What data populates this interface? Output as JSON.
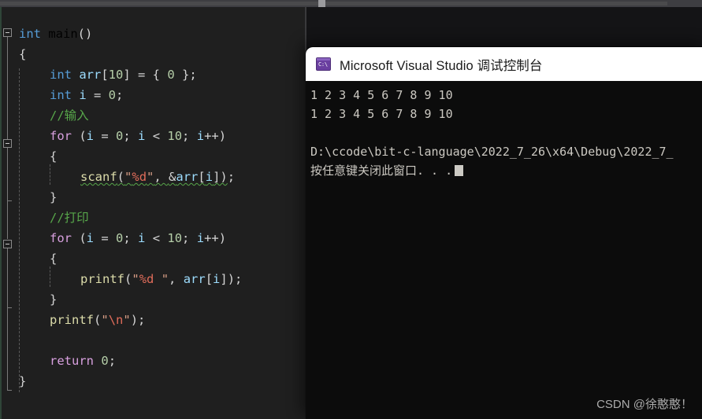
{
  "window": {
    "app": "Visual Studio",
    "theme": "dark"
  },
  "editor": {
    "name": "code-editor",
    "language": "C",
    "code_lines": [
      {
        "indent": 0,
        "tokens": [
          {
            "t": "int ",
            "c": "kw"
          },
          {
            "t": "main",
            "c": "fn-plain"
          },
          {
            "t": "()",
            "c": "punc"
          }
        ]
      },
      {
        "indent": 0,
        "tokens": [
          {
            "t": "{",
            "c": "punc"
          }
        ]
      },
      {
        "indent": 1,
        "tokens": [
          {
            "t": "int ",
            "c": "kw"
          },
          {
            "t": "arr",
            "c": "var"
          },
          {
            "t": "[",
            "c": "punc"
          },
          {
            "t": "10",
            "c": "num"
          },
          {
            "t": "] = { ",
            "c": "punc"
          },
          {
            "t": "0",
            "c": "num"
          },
          {
            "t": " };",
            "c": "punc"
          }
        ]
      },
      {
        "indent": 1,
        "tokens": [
          {
            "t": "int ",
            "c": "kw"
          },
          {
            "t": "i",
            "c": "var"
          },
          {
            "t": " = ",
            "c": "punc"
          },
          {
            "t": "0",
            "c": "num"
          },
          {
            "t": ";",
            "c": "punc"
          }
        ]
      },
      {
        "indent": 1,
        "tokens": [
          {
            "t": "//输入",
            "c": "cmt"
          }
        ]
      },
      {
        "indent": 1,
        "tokens": [
          {
            "t": "for",
            "c": "kw2"
          },
          {
            "t": " (",
            "c": "punc"
          },
          {
            "t": "i",
            "c": "var"
          },
          {
            "t": " = ",
            "c": "punc"
          },
          {
            "t": "0",
            "c": "num"
          },
          {
            "t": "; ",
            "c": "punc"
          },
          {
            "t": "i",
            "c": "var"
          },
          {
            "t": " < ",
            "c": "punc"
          },
          {
            "t": "10",
            "c": "num"
          },
          {
            "t": "; ",
            "c": "punc"
          },
          {
            "t": "i",
            "c": "var"
          },
          {
            "t": "++)",
            "c": "punc"
          }
        ]
      },
      {
        "indent": 1,
        "tokens": [
          {
            "t": "{",
            "c": "punc"
          }
        ]
      },
      {
        "indent": 2,
        "tokens": [
          {
            "t": "scanf",
            "c": "fn squig"
          },
          {
            "t": "(",
            "c": "punc squig"
          },
          {
            "t": "\"",
            "c": "str squig"
          },
          {
            "t": "%d",
            "c": "fmt squig"
          },
          {
            "t": "\"",
            "c": "str squig"
          },
          {
            "t": ", ",
            "c": "punc squig"
          },
          {
            "t": "&",
            "c": "punc squig"
          },
          {
            "t": "arr",
            "c": "var squig"
          },
          {
            "t": "[",
            "c": "punc squig"
          },
          {
            "t": "i",
            "c": "var squig"
          },
          {
            "t": "])",
            "c": "punc squig"
          },
          {
            "t": ";",
            "c": "punc"
          }
        ]
      },
      {
        "indent": 1,
        "tokens": [
          {
            "t": "}",
            "c": "punc"
          }
        ]
      },
      {
        "indent": 1,
        "tokens": [
          {
            "t": "//打印",
            "c": "cmt"
          }
        ]
      },
      {
        "indent": 1,
        "tokens": [
          {
            "t": "for",
            "c": "kw2"
          },
          {
            "t": " (",
            "c": "punc"
          },
          {
            "t": "i",
            "c": "var"
          },
          {
            "t": " = ",
            "c": "punc"
          },
          {
            "t": "0",
            "c": "num"
          },
          {
            "t": "; ",
            "c": "punc"
          },
          {
            "t": "i",
            "c": "var"
          },
          {
            "t": " < ",
            "c": "punc"
          },
          {
            "t": "10",
            "c": "num"
          },
          {
            "t": "; ",
            "c": "punc"
          },
          {
            "t": "i",
            "c": "var"
          },
          {
            "t": "++)",
            "c": "punc"
          }
        ]
      },
      {
        "indent": 1,
        "tokens": [
          {
            "t": "{",
            "c": "punc"
          }
        ]
      },
      {
        "indent": 2,
        "tokens": [
          {
            "t": "printf",
            "c": "fn"
          },
          {
            "t": "(",
            "c": "punc"
          },
          {
            "t": "\"",
            "c": "str"
          },
          {
            "t": "%d",
            "c": "fmt"
          },
          {
            "t": " \"",
            "c": "str"
          },
          {
            "t": ", ",
            "c": "punc"
          },
          {
            "t": "arr",
            "c": "var"
          },
          {
            "t": "[",
            "c": "punc"
          },
          {
            "t": "i",
            "c": "var"
          },
          {
            "t": "]);",
            "c": "punc"
          }
        ]
      },
      {
        "indent": 1,
        "tokens": [
          {
            "t": "}",
            "c": "punc"
          }
        ]
      },
      {
        "indent": 1,
        "tokens": [
          {
            "t": "printf",
            "c": "fn"
          },
          {
            "t": "(",
            "c": "punc"
          },
          {
            "t": "\"",
            "c": "str"
          },
          {
            "t": "\\n",
            "c": "fmt"
          },
          {
            "t": "\"",
            "c": "str"
          },
          {
            "t": ");",
            "c": "punc"
          }
        ]
      },
      {
        "indent": 1,
        "tokens": []
      },
      {
        "indent": 1,
        "tokens": [
          {
            "t": "return",
            "c": "kw2"
          },
          {
            "t": " ",
            "c": "punc"
          },
          {
            "t": "0",
            "c": "num"
          },
          {
            "t": ";",
            "c": "punc"
          }
        ]
      },
      {
        "indent": 0,
        "tokens": [
          {
            "t": "}",
            "c": "punc"
          }
        ]
      }
    ]
  },
  "console": {
    "title": "Microsoft Visual Studio 调试控制台",
    "icon": "console-app-icon",
    "icon_glyph": "C:\\",
    "output_lines": [
      "1 2 3 4 5 6 7 8 9 10",
      "1 2 3 4 5 6 7 8 9 10",
      "",
      "D:\\ccode\\bit-c-language\\2022_7_26\\x64\\Debug\\2022_7_",
      "按任意键关闭此窗口. . ."
    ]
  },
  "watermark": {
    "text": "CSDN @徐憨憨！"
  }
}
